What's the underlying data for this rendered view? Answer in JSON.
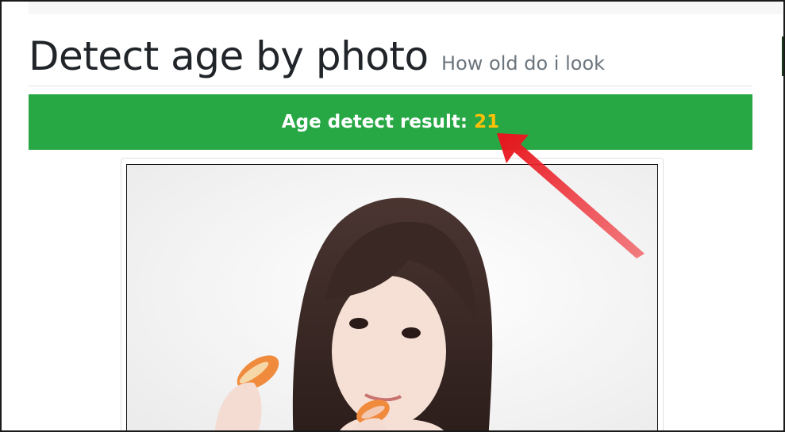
{
  "header": {
    "title": "Detect age by photo",
    "subtitle": "How old do i look"
  },
  "result": {
    "label": "Age detect result:",
    "value": "21",
    "label_color": "#ffffff",
    "value_color": "#ffc107",
    "banner_color": "#28a745"
  },
  "photo": {
    "subject": "photo of a young woman with dark hair holding orange macarons"
  },
  "annotation": {
    "icon": "red-arrow-icon",
    "color": "#e8141c"
  }
}
